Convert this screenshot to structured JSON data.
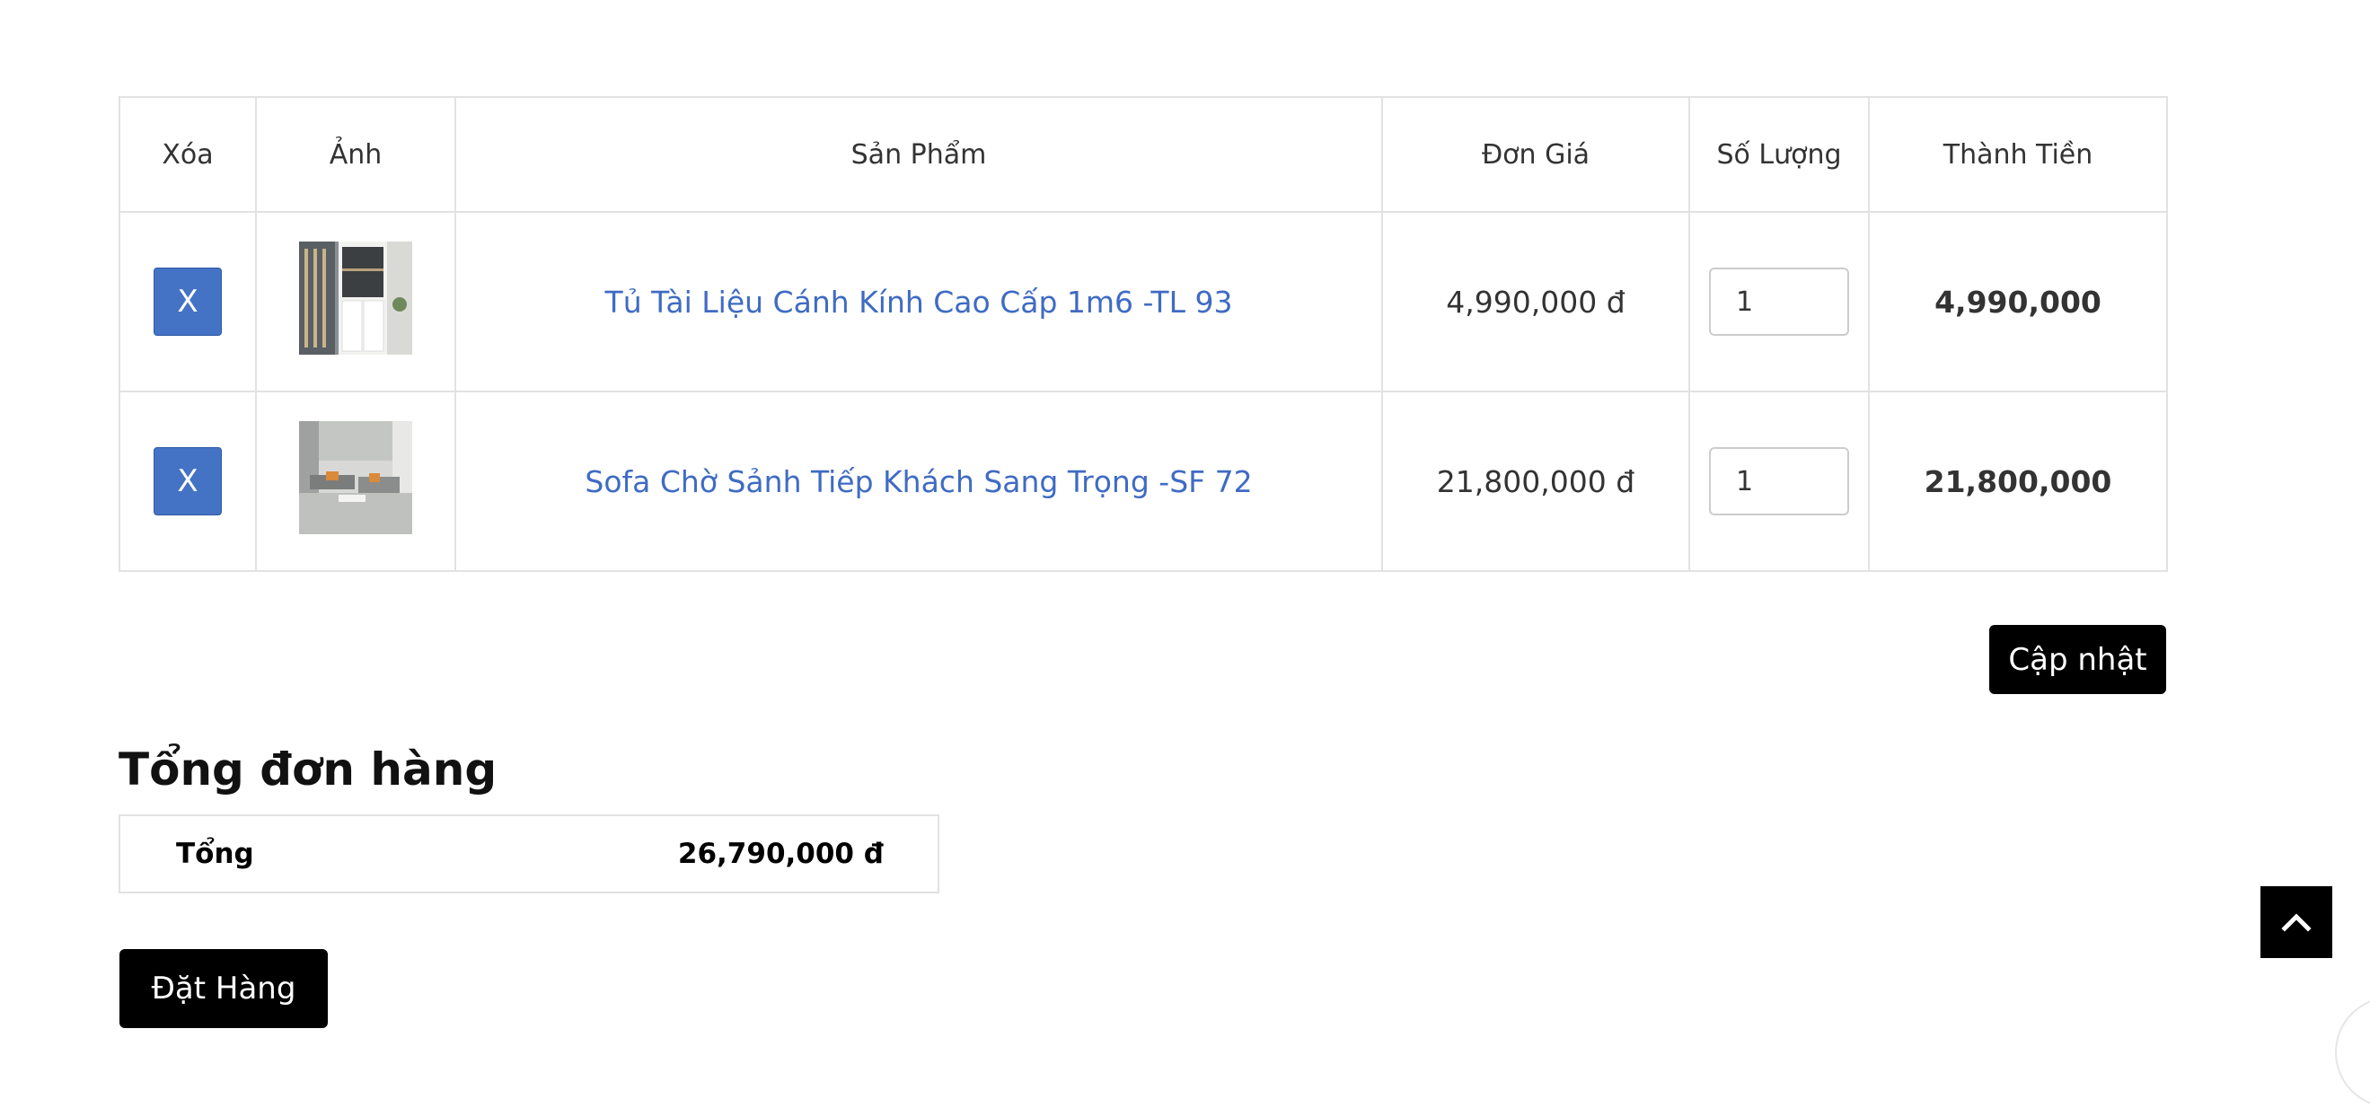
{
  "table": {
    "headers": {
      "delete": "Xóa",
      "image": "Ảnh",
      "product": "Sản Phẩm",
      "unit_price": "Đơn Giá",
      "quantity": "Số Lượng",
      "line_total": "Thành Tiền"
    },
    "rows": [
      {
        "delete_label": "X",
        "image_icon": "cabinet-thumbnail",
        "product_name": "Tủ Tài Liệu Cánh Kính Cao Cấp 1m6 -TL 93",
        "unit_price": "4,990,000 đ",
        "quantity": "1",
        "line_total": "4,990,000"
      },
      {
        "delete_label": "X",
        "image_icon": "sofa-thumbnail",
        "product_name": "Sofa Chờ Sảnh Tiếp Khách Sang Trọng -SF 72",
        "unit_price": "21,800,000 đ",
        "quantity": "1",
        "line_total": "21,800,000"
      }
    ]
  },
  "update_button": "Cập nhật",
  "summary": {
    "title": "Tổng đơn hàng",
    "total_label": "Tổng",
    "total_value": "26,790,000 đ"
  },
  "order_button": "Đặt Hàng",
  "scroll_top_icon": "chevron-up-icon",
  "colors": {
    "delete_button": "#4472c4",
    "link": "#3f6bc4",
    "primary_button": "#000000",
    "border": "#e2e2e2"
  }
}
